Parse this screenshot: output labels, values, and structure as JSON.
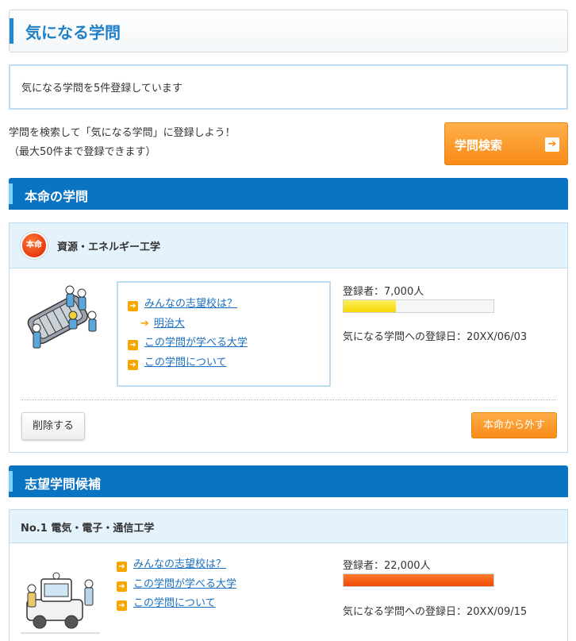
{
  "page": {
    "title": "気になる学問",
    "count_text": "気になる学問を5件登録しています",
    "invite_line1": "学問を検索して「気になる学問」に登録しよう！",
    "invite_line2": "（最大50件まで登録できます）",
    "search_button": "学問検索",
    "search_arrow": "➔"
  },
  "honmei_section": {
    "heading": "本命の学問",
    "card": {
      "badge": "本命",
      "name": "資源・エネルギー工学",
      "links": {
        "shiboukou": "みんなの志望校は？",
        "school": "明治大",
        "universities": "この学問が学べる大学",
        "about": "この学問について"
      },
      "registrants": "登録者：7,000人",
      "registrant_level": 0.35,
      "registered_date": "気になる学問への登録日：20XX/06/03",
      "delete_button": "削除する",
      "unset_button": "本命から外す"
    }
  },
  "candidate_section": {
    "heading": "志望学問候補",
    "card": {
      "name": "No.1 電気・電子・通信工学",
      "links": {
        "shiboukou": "みんなの志望校は？",
        "universities": "この学問が学べる大学",
        "about": "この学問について"
      },
      "registrants": "登録者：22,000人",
      "registrant_level": 1.0,
      "registered_date": "気になる学問への登録日：20XX/09/15"
    }
  },
  "colors": {
    "accent_blue": "#0a74c3",
    "accent_orange": "#f88a18",
    "gauge_yellow": "#f6d800",
    "gauge_red": "#ee4a08"
  }
}
